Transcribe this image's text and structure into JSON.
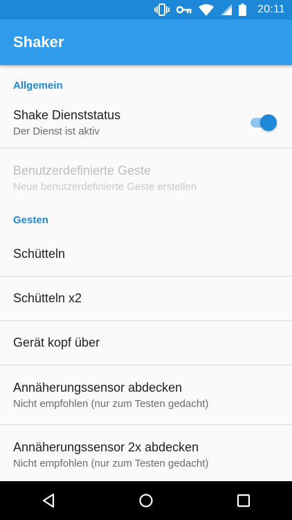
{
  "status_bar": {
    "time": "20:11",
    "icons": [
      "vibrate-icon",
      "vpn-key-icon",
      "wifi-icon",
      "signal-icon",
      "battery-icon"
    ]
  },
  "app_bar": {
    "title": "Shaker"
  },
  "sections": {
    "general": {
      "header": "Allgemein",
      "service": {
        "title": "Shake Dienststatus",
        "summary": "Der Dienst ist aktiv",
        "enabled": true
      },
      "custom_gesture": {
        "title": "Benutzerdefinierte Geste",
        "summary": "Neue benutzerdefinierte Geste erstellen",
        "disabled": true
      }
    },
    "gestures": {
      "header": "Gesten",
      "items": [
        {
          "title": "Schütteln"
        },
        {
          "title": "Schütteln x2"
        },
        {
          "title": "Gerät kopf über"
        },
        {
          "title": "Annäherungssensor abdecken",
          "summary": "Nicht empfohlen (nur zum Testen gedacht)"
        },
        {
          "title": "Annäherungssensor 2x abdecken",
          "summary": "Nicht empfohlen (nur zum Testen gedacht)"
        }
      ]
    }
  },
  "colors": {
    "status_bar": "#1e88d8",
    "app_bar": "#2f9bea",
    "accent": "#1e88d8",
    "switch_track": "#8ec6f0",
    "nav_bar": "#000000"
  },
  "nav_bar": {
    "buttons": [
      "back-icon",
      "home-icon",
      "recents-icon"
    ]
  }
}
